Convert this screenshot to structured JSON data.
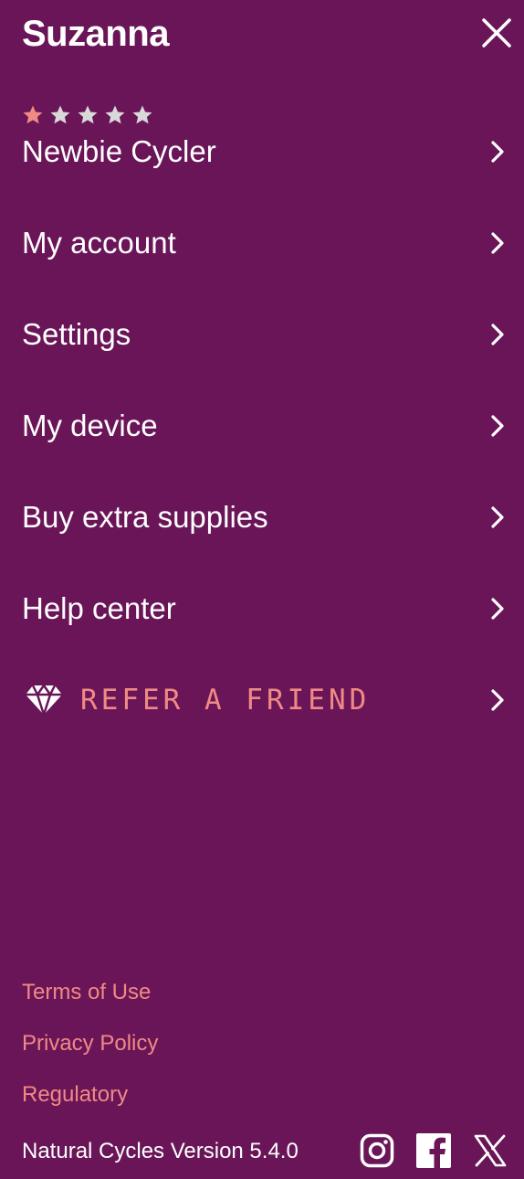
{
  "header": {
    "title": "Suzanna"
  },
  "rating": {
    "filled": 1,
    "total": 5,
    "filled_color": "#f08a84",
    "empty_color": "#d9d9d9"
  },
  "menu": [
    {
      "label": "Newbie Cycler"
    },
    {
      "label": "My account"
    },
    {
      "label": "Settings"
    },
    {
      "label": "My device"
    },
    {
      "label": "Buy extra supplies"
    },
    {
      "label": "Help center"
    }
  ],
  "refer": {
    "label": "REFER A FRIEND",
    "icon": "diamond-icon"
  },
  "footer": {
    "links": [
      "Terms of Use",
      "Privacy Policy",
      "Regulatory"
    ],
    "version": "Natural Cycles Version 5.4.0",
    "social_icons": [
      "instagram-icon",
      "facebook-icon",
      "x-icon"
    ]
  },
  "colors": {
    "background": "#6a1558",
    "accent": "#f08a84",
    "text": "#ffffff"
  }
}
